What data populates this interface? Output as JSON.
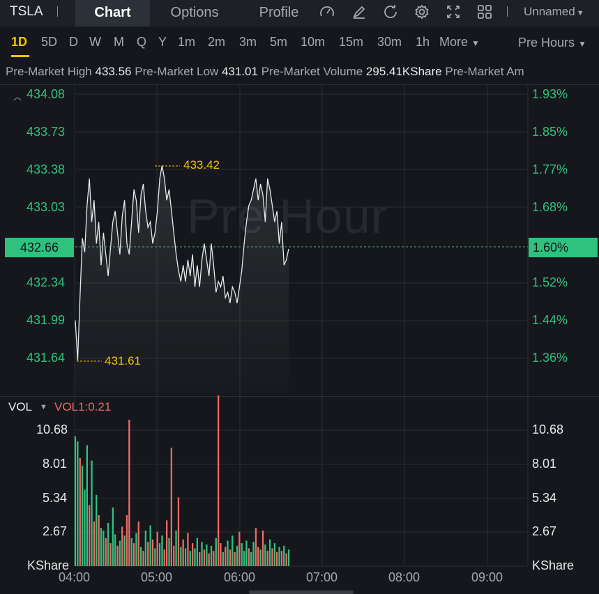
{
  "header": {
    "ticker": "TSLA",
    "tabs": [
      {
        "label": "Chart",
        "active": true
      },
      {
        "label": "Options",
        "active": false
      },
      {
        "label": "Profile",
        "active": false
      }
    ],
    "icons": [
      "gauge-icon",
      "draw-icon",
      "refresh-icon",
      "settings-icon",
      "fullscreen-icon",
      "layout-grid-icon"
    ],
    "layout_name": "Unnamed"
  },
  "timeframes": {
    "items": [
      "1D",
      "5D",
      "D",
      "W",
      "M",
      "Q",
      "Y",
      "1m",
      "2m",
      "3m",
      "5m",
      "10m",
      "15m",
      "30m",
      "1h"
    ],
    "active": "1D",
    "more_label": "More",
    "session_label": "Pre Hours"
  },
  "stats": {
    "high_label": "Pre-Market High",
    "high_value": "433.56",
    "low_label": "Pre-Market Low",
    "low_value": "431.01",
    "volume_label": "Pre-Market Volume",
    "volume_value": "295.41KShare",
    "amount_label": "Pre-Market Am"
  },
  "price_chart": {
    "watermark": "Pre Hour",
    "left_axis": [
      "434.08",
      "433.73",
      "433.38",
      "433.03",
      "432.34",
      "431.99",
      "431.64"
    ],
    "right_axis": [
      "1.93%",
      "1.85%",
      "1.77%",
      "1.68%",
      "1.52%",
      "1.44%",
      "1.36%"
    ],
    "current_price": "432.66",
    "current_pct": "1.60%",
    "high_marker": "433.42",
    "low_marker": "431.61"
  },
  "volume_chart": {
    "label": "VOL",
    "value_label": "VOL1:0.21",
    "axis": [
      "10.68",
      "8.01",
      "5.34",
      "2.67"
    ],
    "unit": "KShare"
  },
  "x_axis": [
    "04:00",
    "05:00",
    "06:00",
    "07:00",
    "08:00",
    "09:00"
  ],
  "colors": {
    "up": "#2ec27e",
    "down": "#f06a63",
    "accent": "#f5c400",
    "background": "#15171c"
  },
  "chart_data": {
    "type": "line",
    "x_range": [
      "04:00",
      "09:30"
    ],
    "ylim": [
      431.47,
      434.08
    ],
    "price": [
      431.99,
      431.62,
      432.2,
      432.75,
      432.62,
      433.05,
      433.3,
      432.9,
      433.1,
      432.7,
      432.9,
      432.5,
      432.8,
      432.6,
      432.4,
      432.65,
      432.9,
      433.0,
      432.8,
      432.6,
      432.95,
      433.1,
      432.7,
      432.6,
      432.9,
      433.2,
      433.1,
      432.8,
      433.15,
      433.25,
      433.0,
      432.85,
      432.9,
      432.7,
      432.8,
      433.0,
      433.3,
      433.42,
      433.3,
      433.1,
      433.2,
      433.0,
      432.8,
      432.6,
      432.45,
      432.35,
      432.5,
      432.35,
      432.55,
      432.4,
      432.6,
      432.3,
      432.5,
      432.3,
      432.55,
      432.7,
      432.55,
      432.4,
      432.7,
      432.5,
      432.25,
      432.35,
      432.3,
      432.4,
      432.2,
      432.25,
      432.15,
      432.3,
      432.25,
      432.15,
      432.3,
      432.45,
      432.7,
      432.9,
      433.05,
      433.1,
      433.2,
      433.3,
      433.1,
      433.25,
      433.15,
      432.9,
      433.3,
      433.2,
      433.05,
      432.9,
      433.0,
      432.7,
      432.9,
      432.5,
      432.55,
      432.65
    ],
    "volume_kshare": [
      10.2,
      9.8,
      8.5,
      7.9,
      6.0,
      9.5,
      4.8,
      8.3,
      3.5,
      5.6,
      4.0,
      3.0,
      2.8,
      2.2,
      3.4,
      1.8,
      4.6,
      2.5,
      1.6,
      2.0,
      3.1,
      2.4,
      4.0,
      11.5,
      2.2,
      1.8,
      2.6,
      3.5,
      1.5,
      1.2,
      2.8,
      1.9,
      3.2,
      2.1,
      1.4,
      2.7,
      1.8,
      2.4,
      1.3,
      3.6,
      2.2,
      9.3,
      1.6,
      2.8,
      5.4,
      1.5,
      2.1,
      1.4,
      2.6,
      1.2,
      1.8,
      1.4,
      2.2,
      1.1,
      1.9,
      1.3,
      1.7,
      1.0,
      1.6,
      1.2,
      2.2,
      13.4,
      1.8,
      1.1,
      1.5,
      2.0,
      1.3,
      2.4,
      1.1,
      1.6,
      2.7,
      1.8,
      1.2,
      2.0,
      1.4,
      1.1,
      1.9,
      3.0,
      1.5,
      1.3,
      2.8,
      1.7,
      1.2,
      2.1,
      1.4,
      1.8,
      1.1,
      1.5,
      1.2,
      1.6,
      1.0,
      1.3
    ],
    "volume_up": [
      true,
      true,
      false,
      true,
      true,
      true,
      false,
      true,
      false,
      true,
      false,
      true,
      true,
      false,
      true,
      false,
      true,
      true,
      false,
      true,
      false,
      true,
      false,
      false,
      true,
      false,
      true,
      false,
      true,
      false,
      true,
      false,
      true,
      false,
      true,
      false,
      true,
      true,
      false,
      false,
      true,
      false,
      false,
      true,
      false,
      true,
      false,
      true,
      false,
      true,
      false,
      true,
      true,
      false,
      true,
      false,
      true,
      false,
      true,
      false,
      true,
      false,
      false,
      true,
      false,
      true,
      false,
      true,
      false,
      true,
      false,
      true,
      true,
      true,
      false,
      true,
      true,
      false,
      false,
      true,
      false,
      true,
      false,
      true,
      false,
      true,
      false,
      true,
      false,
      true,
      false,
      true
    ]
  }
}
